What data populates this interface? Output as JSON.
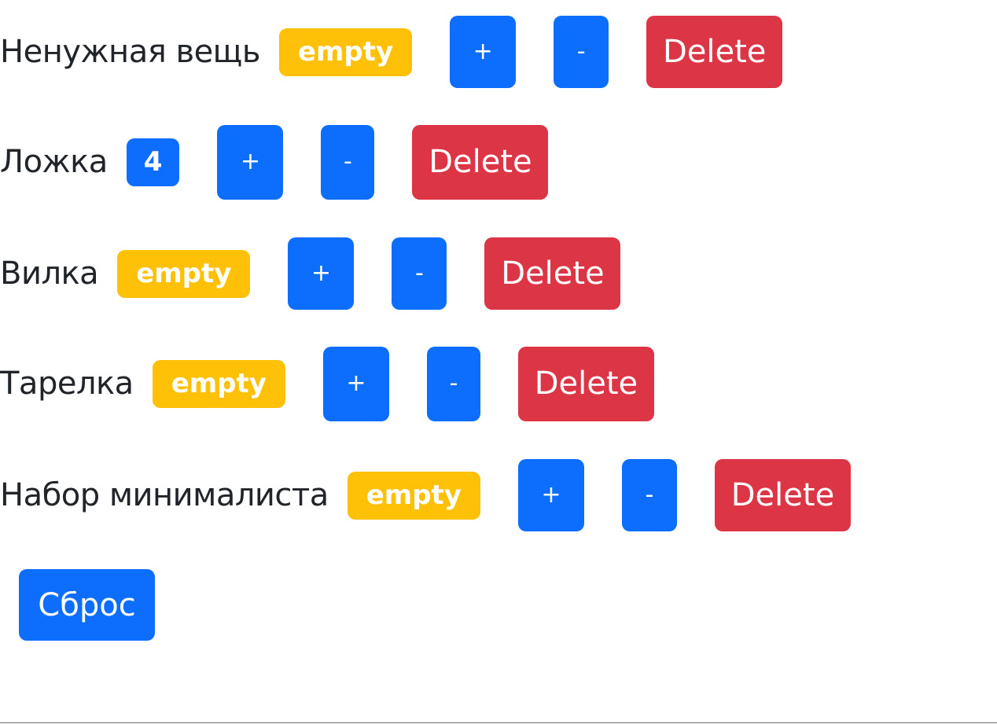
{
  "counters": [
    {
      "name": "Ненужная вещь",
      "value": "empty",
      "increment_label": "+",
      "decrement_label": "-",
      "delete_label": "Delete",
      "badge_color": "#ffc107"
    },
    {
      "name": "Ложка",
      "value": "4",
      "increment_label": "+",
      "decrement_label": "-",
      "delete_label": "Delete",
      "badge_color": "#0d6efd"
    },
    {
      "name": "Вилка",
      "value": "empty",
      "increment_label": "+",
      "decrement_label": "-",
      "delete_label": "Delete",
      "badge_color": "#ffc107"
    },
    {
      "name": "Тарелка",
      "value": "empty",
      "increment_label": "+",
      "decrement_label": "-",
      "delete_label": "Delete",
      "badge_color": "#ffc107"
    },
    {
      "name": "Набор минималиста",
      "value": "empty",
      "increment_label": "+",
      "decrement_label": "-",
      "delete_label": "Delete",
      "badge_color": "#ffc107"
    }
  ],
  "reset_label": "Сброс",
  "colors": {
    "primary": "#0d6efd",
    "warning": "#ffc107",
    "danger": "#dc3545",
    "text": "#212529"
  }
}
